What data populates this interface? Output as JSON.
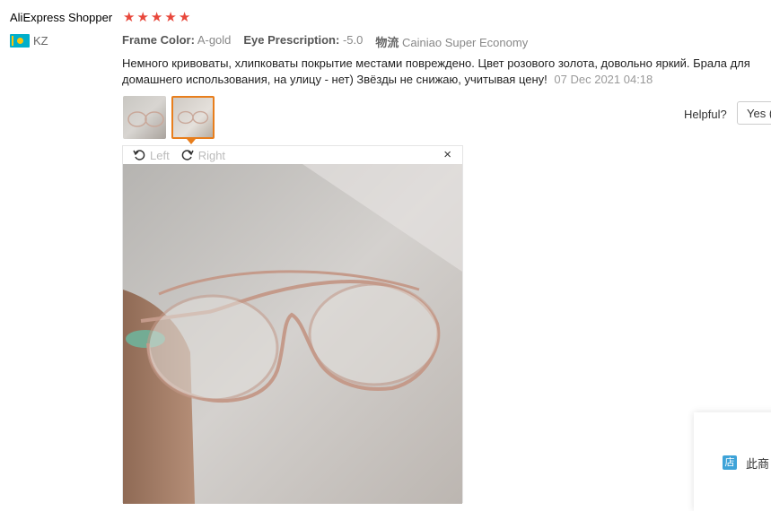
{
  "review": {
    "reviewer": "AliExpress Shopper",
    "rating": 5,
    "country_code": "KZ",
    "frame_color_label": "Frame Color:",
    "frame_color_value": "A-gold",
    "prescription_label": "Eye Prescription:",
    "prescription_value": "-5.0",
    "shipping_label": "物流",
    "shipping_value": "Cainiao Super Economy",
    "text": "Немного кривоваты, хлипковаты покрытие местами повреждено. Цвет розового золота, довольно яркий. Брала для домашнего использования, на улицу - нет) Звёзды не снижаю, учитывая цену!",
    "date": "07 Dec 2021 04:18"
  },
  "helpful": {
    "label": "Helpful?",
    "yes_label": "Yes ("
  },
  "viewer": {
    "rotate_left": "Left",
    "rotate_right": "Right",
    "close": "×"
  },
  "sidecard": {
    "store_icon": "店",
    "text": "此商"
  },
  "colors": {
    "star": "#e8473b",
    "selected_thumb_border": "#e87e1c",
    "store_icon_bg": "#3ea3d8"
  }
}
